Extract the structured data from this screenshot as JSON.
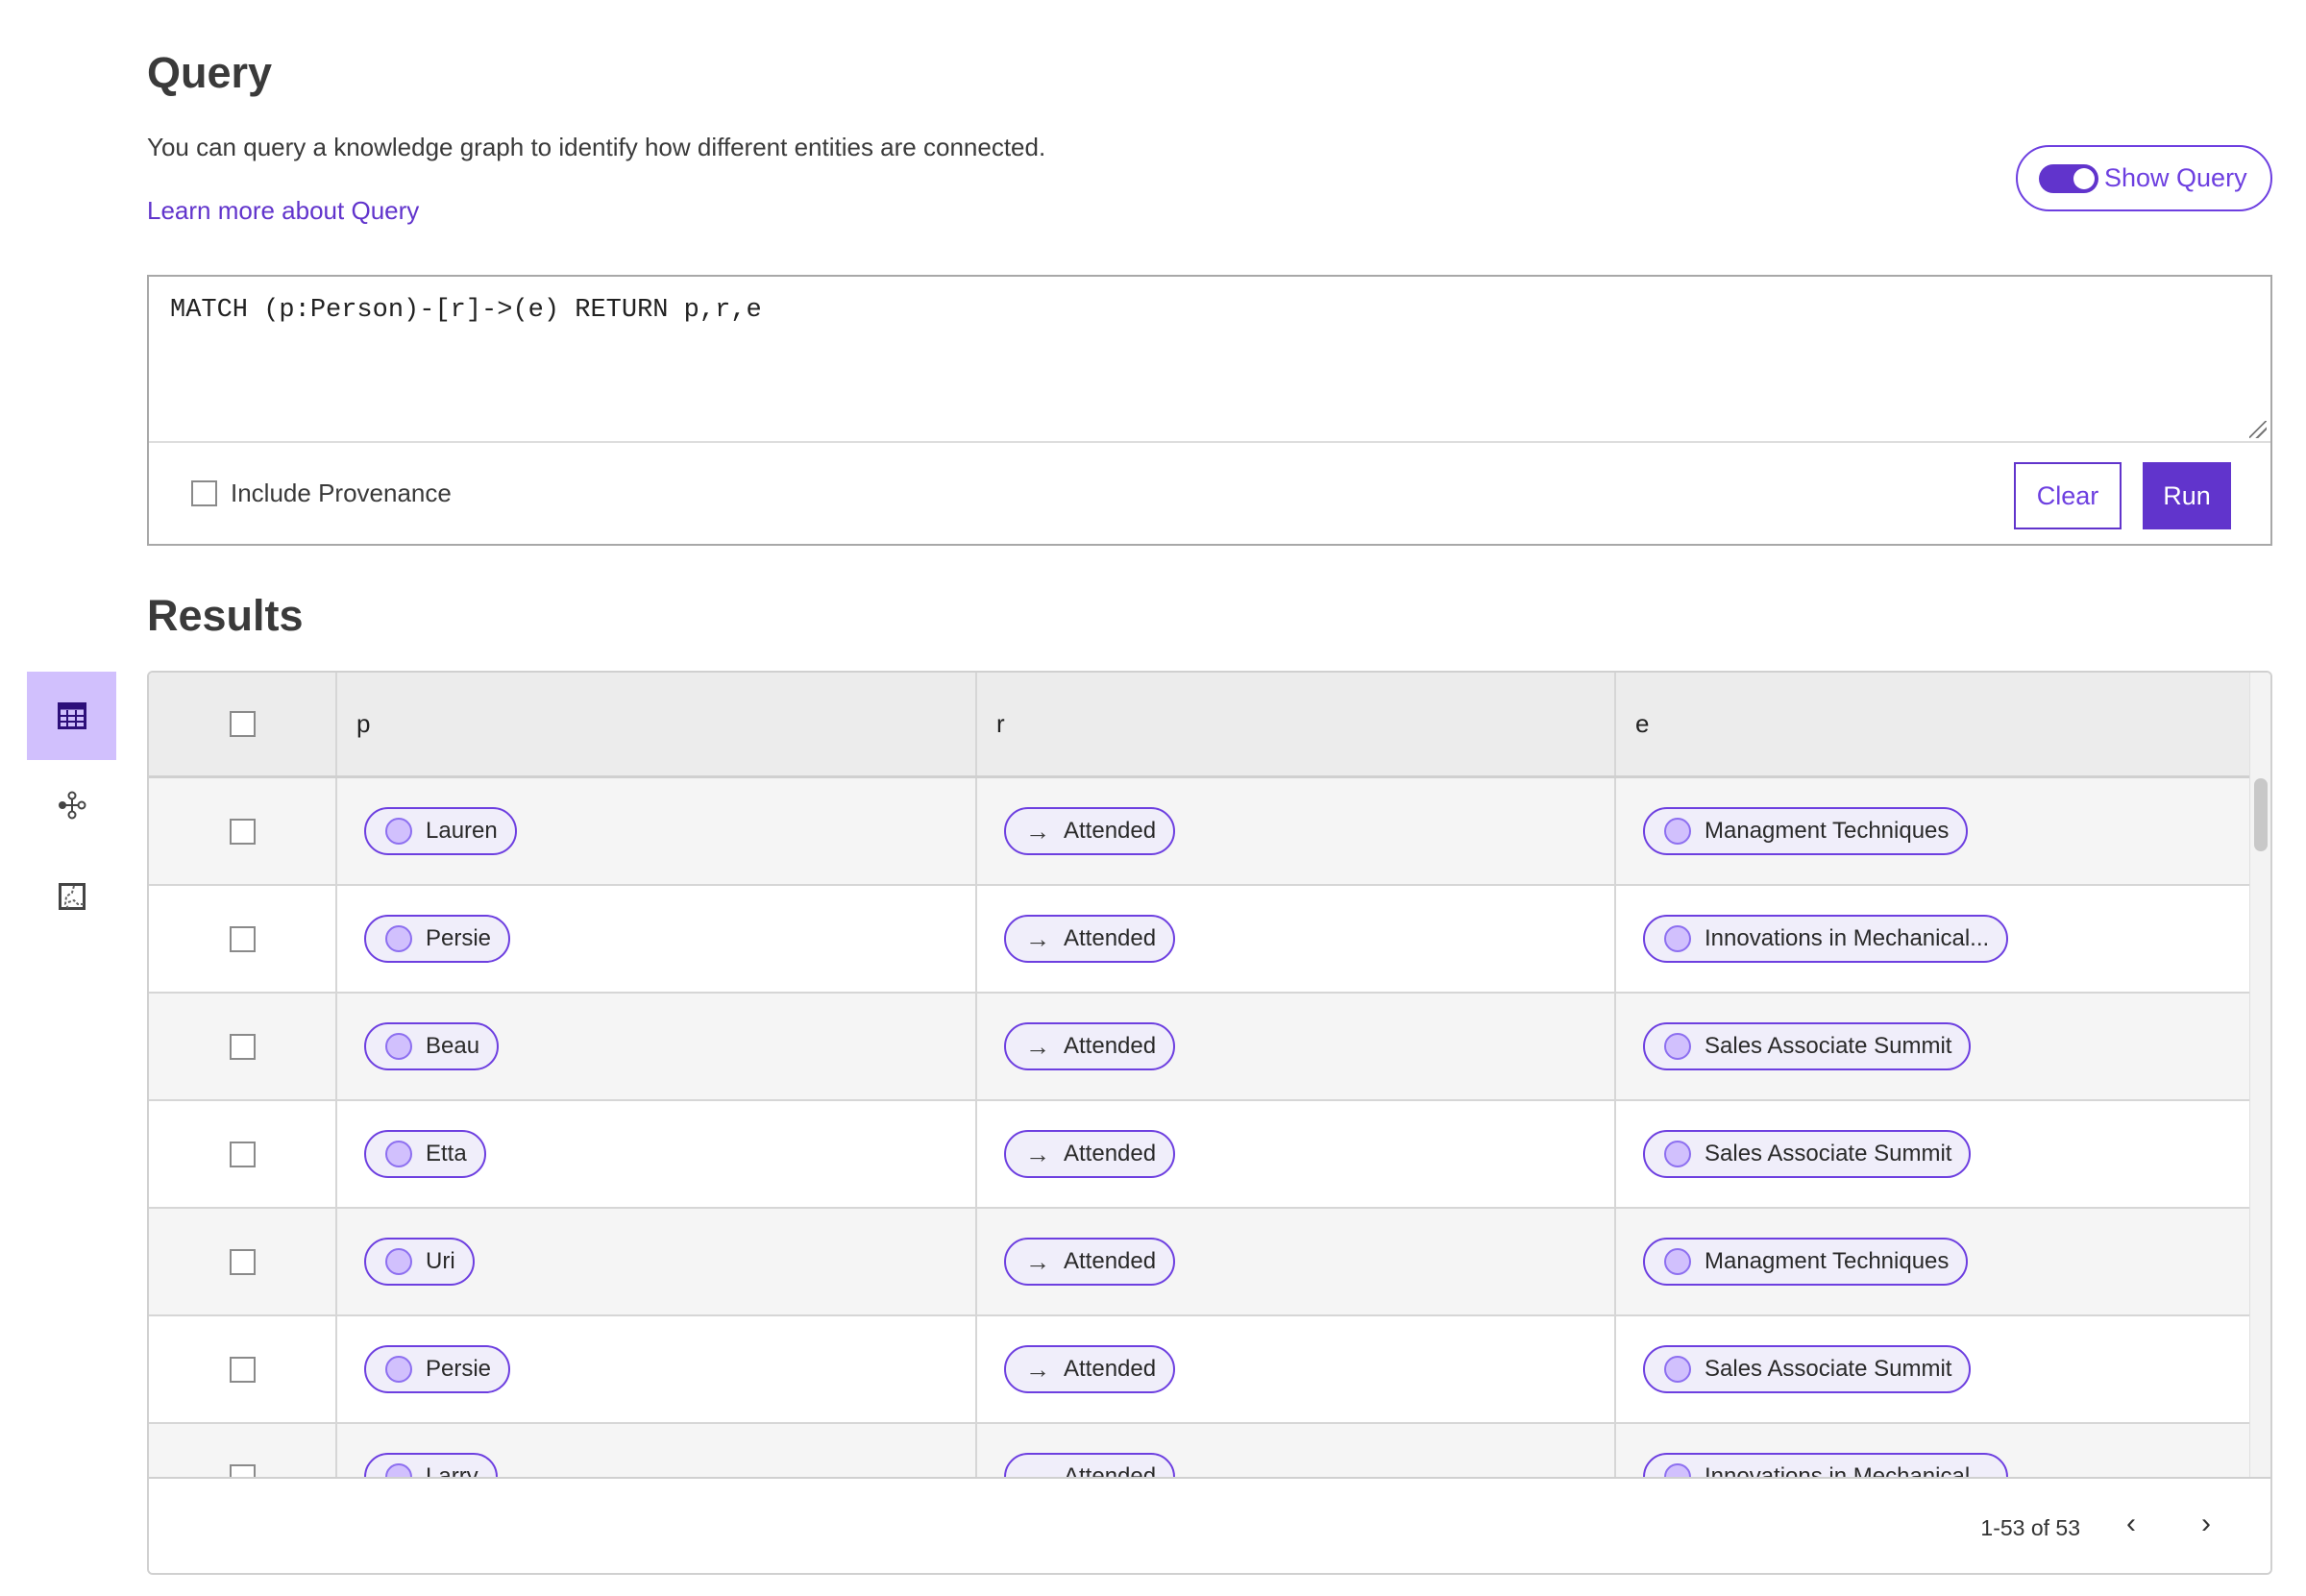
{
  "header": {
    "title": "Query",
    "description": "You can query a knowledge graph to identify how different entities are connected.",
    "learn_more": "Learn more about Query",
    "show_query_label": "Show Query",
    "show_query_on": true
  },
  "query": {
    "text": "MATCH (p:Person)-[r]->(e) RETURN p,r,e",
    "include_provenance_label": "Include Provenance",
    "include_provenance": false,
    "clear_label": "Clear",
    "run_label": "Run"
  },
  "results": {
    "title": "Results",
    "sidebar": [
      {
        "icon": "table-icon",
        "active": true
      },
      {
        "icon": "graph-icon",
        "active": false
      },
      {
        "icon": "map-icon",
        "active": false
      }
    ],
    "columns": [
      "p",
      "r",
      "e"
    ],
    "rows": [
      {
        "p": "Lauren",
        "r": "Attended",
        "e": "Managment Techniques"
      },
      {
        "p": "Persie",
        "r": "Attended",
        "e": "Innovations in Mechanical..."
      },
      {
        "p": "Beau",
        "r": "Attended",
        "e": "Sales Associate Summit"
      },
      {
        "p": "Etta",
        "r": "Attended",
        "e": "Sales Associate Summit"
      },
      {
        "p": "Uri",
        "r": "Attended",
        "e": "Managment Techniques"
      },
      {
        "p": "Persie",
        "r": "Attended",
        "e": "Sales Associate Summit"
      },
      {
        "p": "Larry",
        "r": "Attended",
        "e": "Innovations in Mechanical..."
      }
    ],
    "pagination": "1-53 of 53"
  },
  "colors": {
    "accent": "#6134cc",
    "active_tab": "#d1c0fd",
    "pill_fill": "#f0eefa"
  }
}
